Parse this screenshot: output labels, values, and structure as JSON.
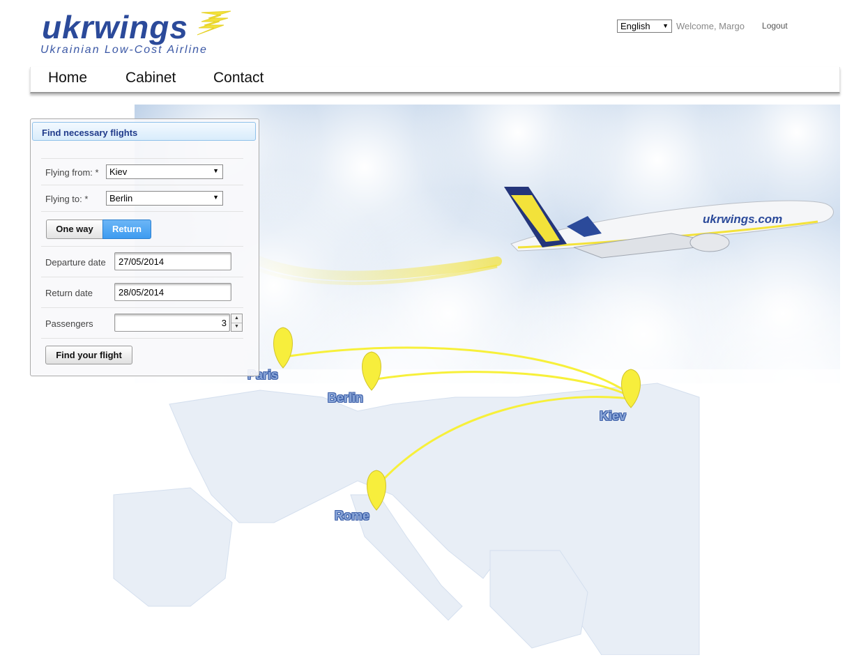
{
  "brand": {
    "name": "ukrwings",
    "tagline": "Ukrainian Low-Cost Airline"
  },
  "header": {
    "language": "English",
    "welcome": "Welcome, Margo",
    "logout": "Logout"
  },
  "nav": {
    "items": [
      "Home",
      "Cabinet",
      "Contact"
    ]
  },
  "search": {
    "title": "Find necessary flights",
    "from_label": "Flying from: *",
    "from_value": "Kiev",
    "to_label": "Flying to: *",
    "to_value": "Berlin",
    "trip_oneway": "One way",
    "trip_return": "Return",
    "departure_label": "Departure date",
    "departure_value": "27/05/2014",
    "return_label": "Return date",
    "return_value": "28/05/2014",
    "passengers_label": "Passengers",
    "passengers_value": "3",
    "submit": "Find your flight"
  },
  "plane": {
    "livery": "ukrwings.com"
  },
  "map": {
    "cities": [
      "Paris",
      "Berlin",
      "Kiev",
      "Rome"
    ]
  },
  "colors": {
    "brand_blue": "#2b4a9a",
    "accent_yellow": "#f5e73a",
    "active_button": "#3d9bf0"
  }
}
